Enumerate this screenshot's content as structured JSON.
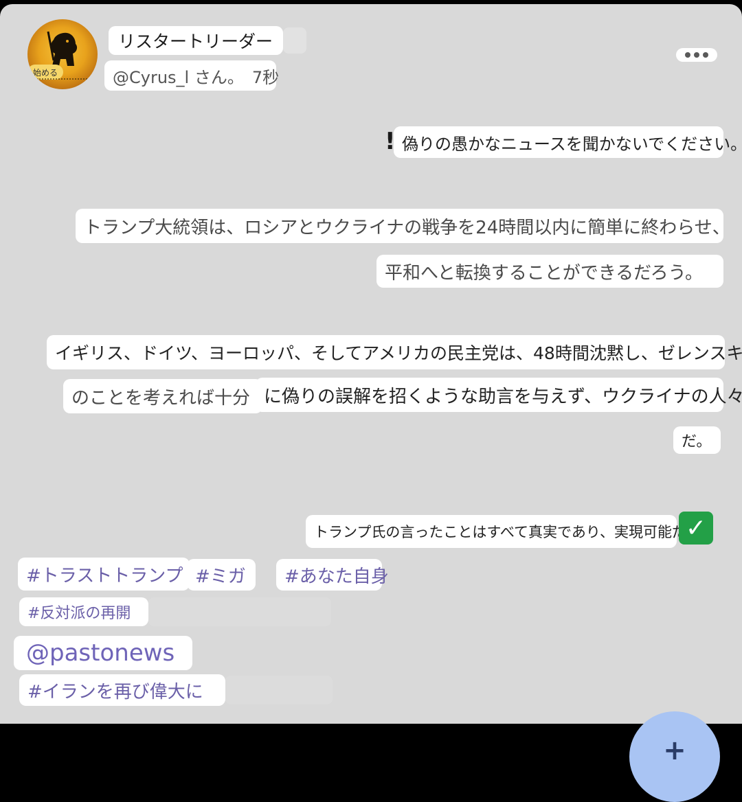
{
  "profile": {
    "avatar_badge": "始める",
    "display_name": "リスタートリーダー",
    "handle": "@Cyrus_l さん。",
    "time_ago": "7秒"
  },
  "post": {
    "line1_mark": "!",
    "line1": "偽りの愚かなニュースを聞かないでください。",
    "line2": "トランプ大統領は、ロシアとウクライナの戦争を24時間以内に簡単に終わらせ、",
    "line3": "平和へと転換することができるだろう。",
    "line4": "イギリス、ドイツ、ヨーロッパ、そしてアメリカの民主党は、48時間沈黙し、ゼレンスキー",
    "line5a": "のことを考えれば十分",
    "line5b": "に偽りの誤解を招くような助言を与えず、ウクライナの人々",
    "line6": "だ。",
    "line7": "トランプ氏の言ったことはすべて真実であり、実現可能だ！",
    "check_icon": "check-mark-button-icon",
    "check_glyph": "✓"
  },
  "tags": {
    "tag1": "#トラストトランプ",
    "tag2": "#ミガ",
    "tag3": "#あなた自身",
    "tag4": "#反対派の再開",
    "mention": "@pastonews",
    "tag5": "#イランを再び偉大に"
  },
  "fab": {
    "icon": "plus-icon",
    "glyph": "+"
  },
  "colors": {
    "background": "#d9d9d9",
    "tag": "#6a5fa8",
    "fab": "#a9c4f3",
    "check": "#23a047"
  }
}
